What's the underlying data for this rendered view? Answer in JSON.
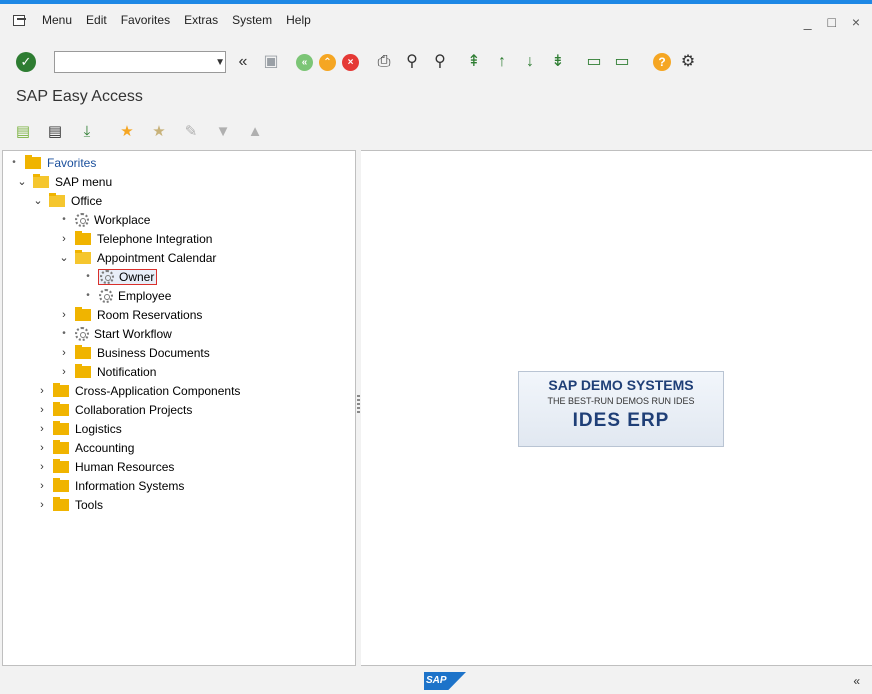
{
  "menubar": {
    "items": [
      "Menu",
      "Edit",
      "Favorites",
      "Extras",
      "System",
      "Help"
    ],
    "window_controls": "_ □ ×"
  },
  "toolbar": {
    "command_field": {
      "value": "",
      "placeholder": ""
    },
    "icons": [
      "enter-check-icon",
      "command-dropdown-icon",
      "back-double-chevron-icon",
      "save-icon",
      "back-icon",
      "exit-icon",
      "cancel-icon",
      "print-icon",
      "find-icon",
      "find-next-icon",
      "first-page-icon",
      "previous-page-icon",
      "next-page-icon",
      "last-page-icon",
      "create-session-icon",
      "shortcut-icon",
      "help-icon",
      "settings-icon"
    ]
  },
  "title": "SAP Easy Access",
  "app_toolbar": {
    "icons": [
      "user-menu-icon",
      "sap-menu-icon",
      "other-menu-icon",
      "add-favorite-icon",
      "delete-favorite-icon",
      "change-favorite-icon",
      "move-down-icon",
      "move-up-icon"
    ]
  },
  "tree": {
    "favorites": "Favorites",
    "sap_menu": "SAP menu",
    "office": "Office",
    "workplace": "Workplace",
    "telephone_integration": "Telephone Integration",
    "appointment_calendar": "Appointment Calendar",
    "owner": "Owner",
    "employee": "Employee",
    "room_reservations": "Room Reservations",
    "start_workflow": "Start Workflow",
    "business_documents": "Business Documents",
    "notification": "Notification",
    "cross_application": "Cross-Application Components",
    "collaboration_projects": "Collaboration Projects",
    "logistics": "Logistics",
    "accounting": "Accounting",
    "human_resources": "Human Resources",
    "information_systems": "Information Systems",
    "tools": "Tools"
  },
  "logo": {
    "line1": "SAP DEMO SYSTEMS",
    "line2": "THE BEST-RUN DEMOS RUN IDES",
    "line3": "IDES ERP"
  },
  "status": {
    "sap_logo": "SAP",
    "collapse": "«"
  },
  "colors": {
    "accent_blue": "#1e88e5",
    "folder_yellow": "#f0b400",
    "enter_green": "#2e7d32",
    "selection_red": "#d9302c"
  }
}
